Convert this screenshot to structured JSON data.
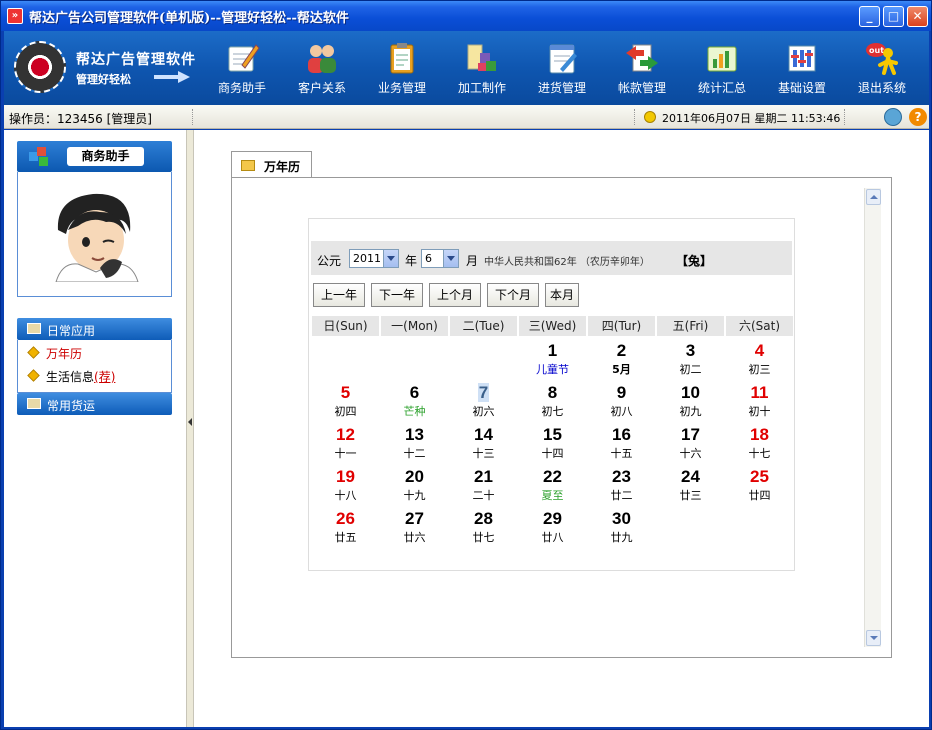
{
  "window": {
    "title": "帮达广告公司管理软件(单机版)--管理好轻松--帮达软件",
    "icon": "rss-icon",
    "minimize": "_",
    "maximize": "□",
    "close": "✕"
  },
  "banner": {
    "logo_title": "帮达广告管理软件",
    "logo_sub": "管理好轻松",
    "tools": [
      {
        "label": "商务助手",
        "icon": "pen-icon"
      },
      {
        "label": "客户关系",
        "icon": "people-icon"
      },
      {
        "label": "业务管理",
        "icon": "clipboard-icon"
      },
      {
        "label": "加工制作",
        "icon": "boxes-icon"
      },
      {
        "label": "进货管理",
        "icon": "notepad-icon"
      },
      {
        "label": "帐款管理",
        "icon": "transfer-icon"
      },
      {
        "label": "统计汇总",
        "icon": "chart-icon"
      },
      {
        "label": "基础设置",
        "icon": "settings-icon"
      },
      {
        "label": "退出系统",
        "icon": "exit-icon"
      }
    ]
  },
  "status": {
    "operator": "操作员：123456 [管理员]",
    "datetime": "2011年06月07日  星期二  11:53:46",
    "help": "?"
  },
  "sidebar": {
    "panel_title": "商务助手",
    "groups": [
      {
        "label": "日常应用",
        "items": [
          {
            "label": "万年历"
          },
          {
            "label": "生活信息",
            "tag": "(荐)"
          }
        ]
      },
      {
        "label": "常用货运"
      }
    ]
  },
  "tab": {
    "label": "万年历"
  },
  "calendar": {
    "era_label": "公元",
    "year_value": "2011",
    "year_unit": "年",
    "month_value": "6",
    "month_unit": "月",
    "republic": "中华人民共和国62年 （农历辛卯年）",
    "zodiac": "【兔】",
    "buttons": {
      "prev_year": "上一年",
      "next_year": "下一年",
      "prev_month": "上个月",
      "next_month": "下个月",
      "this_month": "本月"
    },
    "weekdays": [
      "日(Sun)",
      "一(Mon)",
      "二(Tue)",
      "三(Wed)",
      "四(Tur)",
      "五(Fri)",
      "六(Sat)"
    ],
    "days": [
      {
        "n": "1",
        "lunar": "儿童节",
        "kind": "holiday"
      },
      {
        "n": "2",
        "lunar": "5月",
        "kind": "month"
      },
      {
        "n": "3",
        "lunar": "初二",
        "kind": ""
      },
      {
        "n": "4",
        "lunar": "初三",
        "kind": ""
      },
      {
        "n": "5",
        "lunar": "初四",
        "kind": ""
      },
      {
        "n": "6",
        "lunar": "芒种",
        "kind": "term"
      },
      {
        "n": "7",
        "lunar": "初六",
        "kind": "today"
      },
      {
        "n": "8",
        "lunar": "初七",
        "kind": ""
      },
      {
        "n": "9",
        "lunar": "初八",
        "kind": ""
      },
      {
        "n": "10",
        "lunar": "初九",
        "kind": ""
      },
      {
        "n": "11",
        "lunar": "初十",
        "kind": ""
      },
      {
        "n": "12",
        "lunar": "十一",
        "kind": ""
      },
      {
        "n": "13",
        "lunar": "十二",
        "kind": ""
      },
      {
        "n": "14",
        "lunar": "十三",
        "kind": ""
      },
      {
        "n": "15",
        "lunar": "十四",
        "kind": ""
      },
      {
        "n": "16",
        "lunar": "十五",
        "kind": ""
      },
      {
        "n": "17",
        "lunar": "十六",
        "kind": ""
      },
      {
        "n": "18",
        "lunar": "十七",
        "kind": ""
      },
      {
        "n": "19",
        "lunar": "十八",
        "kind": ""
      },
      {
        "n": "20",
        "lunar": "十九",
        "kind": ""
      },
      {
        "n": "21",
        "lunar": "二十",
        "kind": ""
      },
      {
        "n": "22",
        "lunar": "夏至",
        "kind": "term"
      },
      {
        "n": "23",
        "lunar": "廿二",
        "kind": ""
      },
      {
        "n": "24",
        "lunar": "廿三",
        "kind": ""
      },
      {
        "n": "25",
        "lunar": "廿四",
        "kind": ""
      },
      {
        "n": "26",
        "lunar": "廿五",
        "kind": ""
      },
      {
        "n": "27",
        "lunar": "廿六",
        "kind": ""
      },
      {
        "n": "28",
        "lunar": "廿七",
        "kind": ""
      },
      {
        "n": "29",
        "lunar": "廿八",
        "kind": ""
      },
      {
        "n": "30",
        "lunar": "廿九",
        "kind": ""
      }
    ]
  },
  "colors": {
    "titlebar": "#0a4ed6",
    "banner": "#0f56b0",
    "weekend": "#e00000",
    "holiday": "#0000cc",
    "solar_term": "#2aa02a"
  }
}
